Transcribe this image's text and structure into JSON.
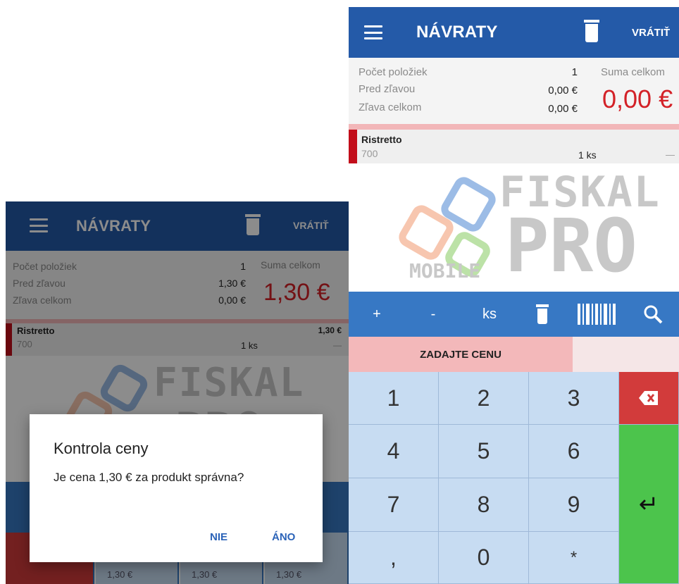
{
  "left": {
    "appbar": {
      "title": "NÁVRATY",
      "action": "VRÁTIŤ"
    },
    "summary": {
      "count_label": "Počet položiek",
      "count_value": "1",
      "before_label": "Pred zľavou",
      "before_value": "1,30 €",
      "discount_label": "Zľava celkom",
      "discount_value": "0,00 €",
      "total_label": "Suma celkom",
      "total_value": "1,30 €"
    },
    "item": {
      "name": "Ristretto",
      "code": "700",
      "qty": "1 ks",
      "price": "1,30 €",
      "dash": "—"
    },
    "logo": {
      "fiskal": "FISKAL",
      "pro": "PRO"
    },
    "dialog": {
      "title": "Kontrola ceny",
      "message": "Je cena 1,30 € za produkt správna?",
      "no": "NIE",
      "yes": "ÁNO"
    },
    "bottom_keys": [
      "1,30 €",
      "1,30 €",
      "1,30 €"
    ]
  },
  "right": {
    "appbar": {
      "title": "NÁVRATY",
      "action": "VRÁTIŤ"
    },
    "summary": {
      "count_label": "Počet položiek",
      "count_value": "1",
      "before_label": "Pred zľavou",
      "before_value": "0,00 €",
      "discount_label": "Zľava celkom",
      "discount_value": "0,00 €",
      "total_label": "Suma celkom",
      "total_value": "0,00 €"
    },
    "item": {
      "name": "Ristretto",
      "code": "700",
      "qty": "1 ks",
      "dash": "—"
    },
    "logo": {
      "fiskal": "FISKAL",
      "pro": "PRO",
      "mobile": "MOBILE"
    },
    "toolbar": {
      "plus": "+",
      "minus": "-",
      "unit": "ks"
    },
    "price_prompt": "ZADAJTE CENU",
    "keys": {
      "k1": "1",
      "k2": "2",
      "k3": "3",
      "k4": "4",
      "k5": "5",
      "k6": "6",
      "k7": "7",
      "k8": "8",
      "k9": "9",
      "comma": ",",
      "k0": "0",
      "star": "*",
      "enter": "↵"
    }
  },
  "colors": {
    "appbar": "#245aa8",
    "toolbar": "#3778c4",
    "total": "#d32127",
    "key": "#c7dcf2",
    "backspace": "#d23b3b",
    "enter": "#4cc44c",
    "prompt": "#f3b8ba"
  },
  "icons": [
    "menu-icon",
    "trash-icon",
    "barcode-icon",
    "search-icon",
    "backspace-icon",
    "enter-icon"
  ]
}
